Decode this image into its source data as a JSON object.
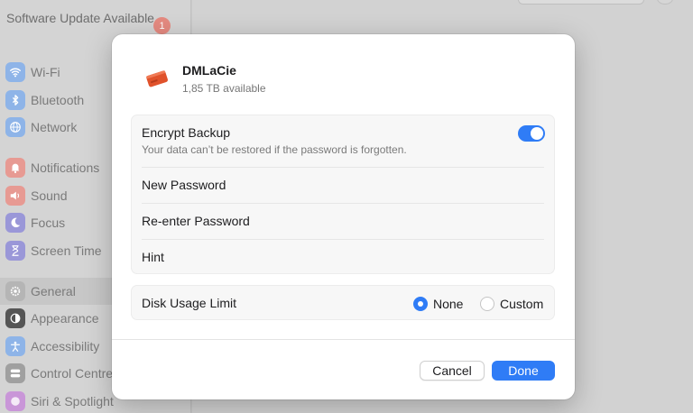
{
  "sidebar": {
    "update_text": "Software Update Available",
    "update_badge": "1",
    "items": [
      {
        "label": "Wi-Fi",
        "icon": "wifi-icon",
        "color": "#8eb4e8"
      },
      {
        "label": "Bluetooth",
        "icon": "bluetooth-icon",
        "color": "#8eb4e8"
      },
      {
        "label": "Network",
        "icon": "globe-icon",
        "color": "#8eb4e8"
      },
      {
        "label": "Notifications",
        "icon": "bell-icon",
        "color": "#e79a93"
      },
      {
        "label": "Sound",
        "icon": "speaker-icon",
        "color": "#e79a93"
      },
      {
        "label": "Focus",
        "icon": "moon-icon",
        "color": "#9a97d8"
      },
      {
        "label": "Screen Time",
        "icon": "hourglass-icon",
        "color": "#9a97d8"
      },
      {
        "label": "General",
        "icon": "gear-icon",
        "color": "#b5b5b5"
      },
      {
        "label": "Appearance",
        "icon": "appearance-icon",
        "color": "#555555"
      },
      {
        "label": "Accessibility",
        "icon": "accessibility-icon",
        "color": "#8eb4e8"
      },
      {
        "label": "Control Centre",
        "icon": "control-centre-icon",
        "color": "#a0a0a0"
      },
      {
        "label": "Siri & Spotlight",
        "icon": "siri-icon",
        "color": "#c996d8"
      }
    ]
  },
  "dialog": {
    "disk_name": "DMLaCie",
    "disk_available": "1,85 TB available",
    "encrypt_label": "Encrypt Backup",
    "encrypt_sub": "Your data can’t be restored if the password is forgotten.",
    "encrypt_on": true,
    "new_password_label": "New Password",
    "reenter_label": "Re-enter Password",
    "hint_label": "Hint",
    "usage_label": "Disk Usage Limit",
    "radio_none": "None",
    "radio_custom": "Custom",
    "selected_option": "None",
    "cancel_label": "Cancel",
    "done_label": "Done"
  },
  "colors": {
    "accent": "#2f7cf6",
    "disk_icon": "#e0522b"
  }
}
